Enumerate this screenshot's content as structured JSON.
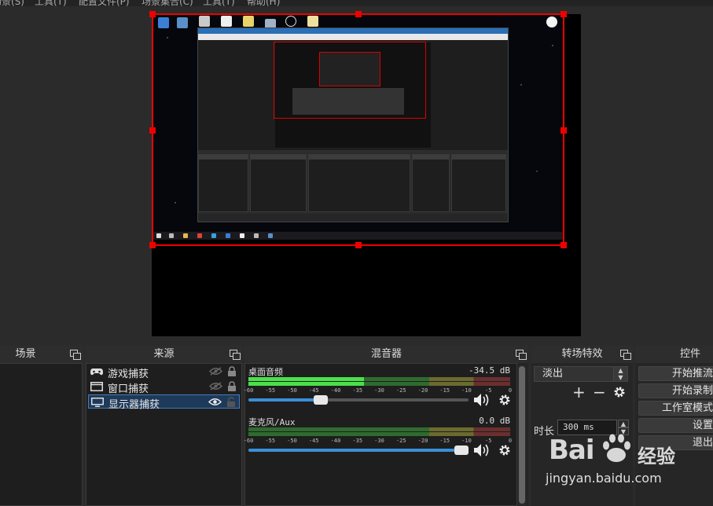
{
  "menubar": {
    "items": [
      "场景(S)",
      "工具(T)",
      "配置文件(P)",
      "场景集合(C)",
      "工具(T)",
      "帮助(H)"
    ]
  },
  "scenes_dock": {
    "title": "场景"
  },
  "sources_dock": {
    "title": "来源",
    "items": [
      {
        "label": "游戏捕获",
        "icon": "gamepad-icon",
        "visible": false,
        "locked": true,
        "selected": false
      },
      {
        "label": "窗口捕获",
        "icon": "window-icon",
        "visible": false,
        "locked": true,
        "selected": false
      },
      {
        "label": "显示器捕获",
        "icon": "monitor-icon",
        "visible": true,
        "locked": false,
        "selected": true
      }
    ]
  },
  "mixer_dock": {
    "title": "混音器",
    "scale_ticks": [
      "-60",
      "-55",
      "-50",
      "-45",
      "-40",
      "-35",
      "-30",
      "-25",
      "-20",
      "-15",
      "-10",
      "-5",
      "0"
    ],
    "channels": [
      {
        "name": "桌面音频",
        "db": "-34.5 dB",
        "level_fraction": 0.44,
        "volume_fraction": 0.33
      },
      {
        "name": "麦克风/Aux",
        "db": "0.0 dB",
        "level_fraction": 0.0,
        "volume_fraction": 1.0
      }
    ]
  },
  "transitions_dock": {
    "title": "转场特效",
    "transition_value": "淡出",
    "duration_label": "时长",
    "duration_value": "300 ms",
    "add_label": "+",
    "remove_label": "−"
  },
  "controls_dock": {
    "title": "控件",
    "buttons": [
      "开始推流",
      "开始录制",
      "工作室模式",
      "设置",
      "退出"
    ]
  },
  "watermark": {
    "brand": "Bai",
    "brand_cn": "经验",
    "url": "jingyan.baidu.com"
  },
  "colors": {
    "selection": "#e00000",
    "accent": "#3a8fd8",
    "meter_green": "#4be04b"
  }
}
